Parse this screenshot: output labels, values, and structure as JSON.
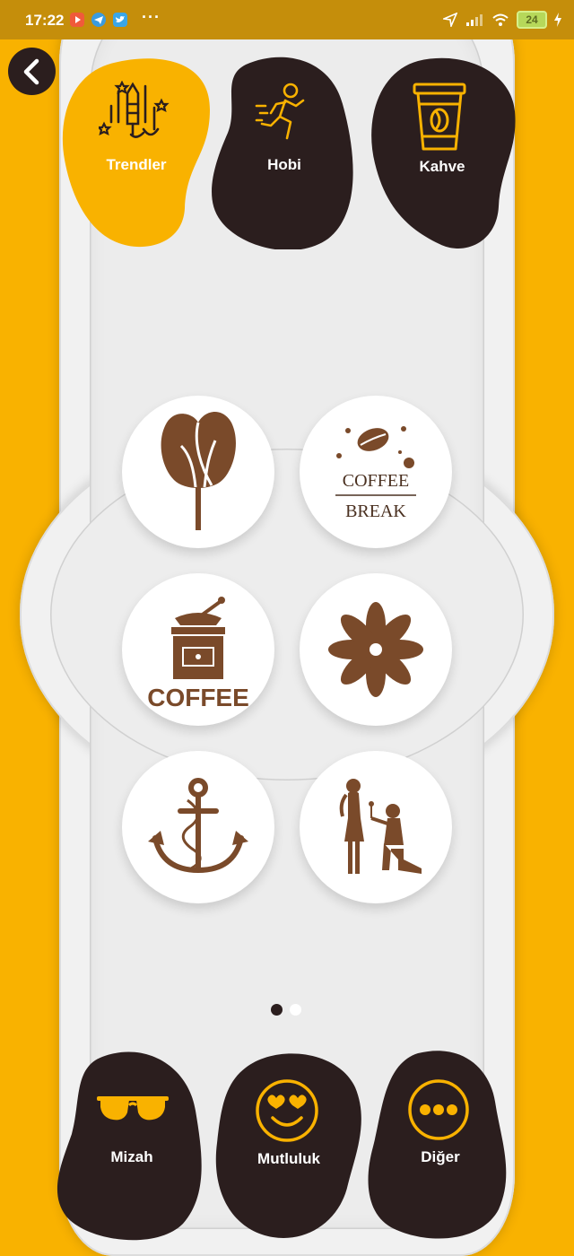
{
  "status_bar": {
    "time": "17:22",
    "more": "···",
    "battery": "24",
    "app_icons": [
      "youtube-icon",
      "telegram-icon",
      "twitter-icon"
    ]
  },
  "colors": {
    "background": "#F9B200",
    "active": "#F9B200",
    "dark": "#2B1E1E",
    "brown": "#7A4A2A"
  },
  "categories": [
    {
      "label": "Trendler",
      "icon": "fireworks-icon",
      "active": true
    },
    {
      "label": "Hobi",
      "icon": "runner-icon",
      "active": false
    },
    {
      "label": "Kahve",
      "icon": "coffee-cup-icon",
      "active": false
    }
  ],
  "grid": [
    {
      "icon": "coffee-bean-tulip-icon"
    },
    {
      "icon": "coffee-break-icon",
      "text": [
        "COFFEE",
        "BREAK"
      ]
    },
    {
      "icon": "coffee-grinder-icon",
      "text": [
        "COFFEE"
      ]
    },
    {
      "icon": "star-anise-icon"
    },
    {
      "icon": "anchor-icon"
    },
    {
      "icon": "couple-proposal-icon"
    }
  ],
  "pager": {
    "current": 1,
    "total": 2
  },
  "bottom_nav": [
    {
      "label": "Mizah",
      "icon": "sunglasses-icon"
    },
    {
      "label": "Mutluluk",
      "icon": "heart-eyes-smiley-icon"
    },
    {
      "label": "Diğer",
      "icon": "more-dots-icon"
    }
  ]
}
